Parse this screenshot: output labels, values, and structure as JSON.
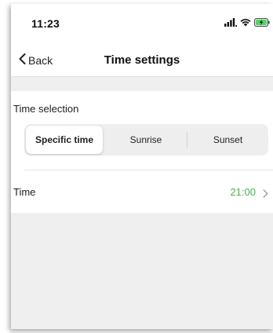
{
  "status_bar": {
    "time": "11:23",
    "icons": [
      "cellular-signal-icon",
      "wifi-icon",
      "battery-charging-icon"
    ],
    "battery_color": "#4cd964"
  },
  "nav": {
    "back_label": "Back",
    "title": "Time settings"
  },
  "time_selection": {
    "label": "Time selection",
    "options": [
      "Specific time",
      "Sunrise",
      "Sunset"
    ],
    "selected": "Specific time"
  },
  "time_row": {
    "label": "Time",
    "value": "21:00",
    "value_color": "#4caf50"
  },
  "colors": {
    "accent_green": "#4caf50",
    "background_gray": "#efefef"
  }
}
